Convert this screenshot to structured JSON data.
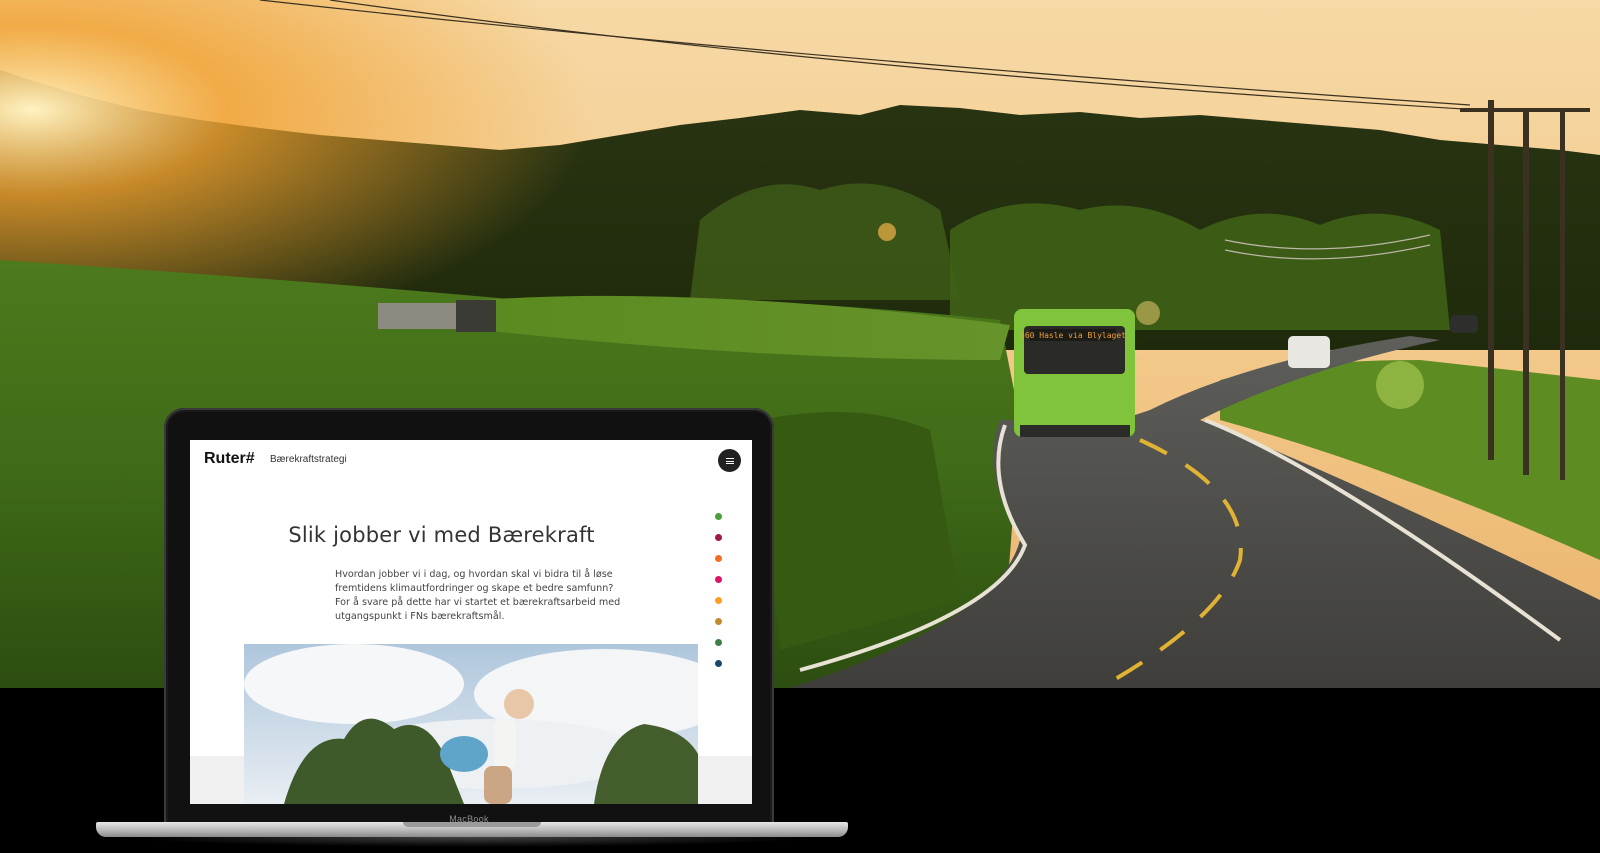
{
  "laptop": {
    "brand_label": "MacBook"
  },
  "site": {
    "logo": "Ruter#",
    "nav_title": "Bærekraftstrategi",
    "headline": "Slik jobber vi med Bærekraft",
    "intro": "Hvordan jobber vi i dag, og hvordan skal vi bidra til å løse fremtidens klimautfordringer og skape et bedre samfunn? For å svare på dette har vi startet et bærekraftsarbeid med utgangspunkt i FNs bærekraftsmål.",
    "section_dots": [
      {
        "color": "#4c9f38"
      },
      {
        "color": "#a21942"
      },
      {
        "color": "#f36d25"
      },
      {
        "color": "#dd1367"
      },
      {
        "color": "#fd9d24"
      },
      {
        "color": "#bf8b2e"
      },
      {
        "color": "#3f7e44"
      },
      {
        "color": "#19486a"
      }
    ]
  },
  "hero": {
    "bus_destination": "560 Hasle via Blylaget"
  }
}
